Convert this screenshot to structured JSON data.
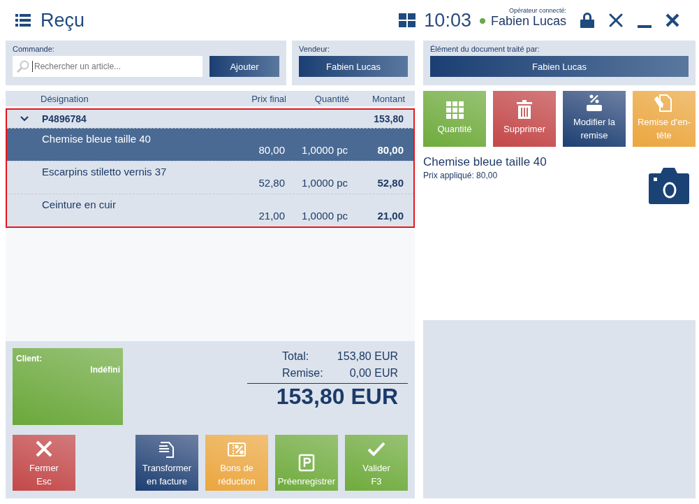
{
  "header": {
    "title": "Reçu",
    "time": "10:03",
    "operator_label": "Opérateur connecté:",
    "operator": "Fabien Lucas",
    "online": true
  },
  "order": {
    "label": "Commande:",
    "placeholder": "Rechercher un article...",
    "add_button": "Ajouter"
  },
  "seller": {
    "label": "Vendeur:",
    "value": "Fabien Lucas"
  },
  "processed_by": {
    "label": "Élément du document traité par:",
    "value": "Fabien Lucas"
  },
  "table": {
    "columns": [
      "Désignation",
      "Prix final",
      "Quantité",
      "Montant"
    ],
    "group": {
      "code": "P4896784",
      "amount": "153,80",
      "expanded": true
    },
    "rows": [
      {
        "name": "Chemise bleue taille 40",
        "price": "80,00",
        "quantity": "1,0000 pc",
        "amount": "80,00",
        "selected": true
      },
      {
        "name": "Escarpins stiletto vernis 37",
        "price": "52,80",
        "quantity": "1,0000 pc",
        "amount": "52,80",
        "selected": false
      },
      {
        "name": "Ceinture en cuir",
        "price": "21,00",
        "quantity": "1,0000 pc",
        "amount": "21,00",
        "selected": false
      }
    ]
  },
  "item_actions": [
    {
      "label": "Quantité",
      "kind": "confirm"
    },
    {
      "label": "Supprimer",
      "kind": "danger"
    },
    {
      "label": "Modifier la remise",
      "kind": "primary"
    },
    {
      "label": "Remise d'en-tête",
      "kind": "warning"
    }
  ],
  "detail": {
    "name": "Chemise bleue taille 40",
    "price": "Prix appliqué: 80,00"
  },
  "client": {
    "label": "Client:",
    "value": "Indéfini"
  },
  "totals": {
    "total_label": "Total:",
    "total": "153,80 EUR",
    "discount_label": "Remise:",
    "discount": "0,00 EUR",
    "grand_total": "153,80 EUR"
  },
  "footer_actions": [
    {
      "label": "Fermer",
      "shortcut": "Esc",
      "kind": "danger"
    },
    {
      "label": "Transformer en facture",
      "kind": "primary"
    },
    {
      "label": "Bons de réduction",
      "kind": "warning"
    },
    {
      "label": "Préenregistrer",
      "kind": "confirm"
    },
    {
      "label": "Valider",
      "shortcut": "F3",
      "kind": "confirm"
    }
  ]
}
